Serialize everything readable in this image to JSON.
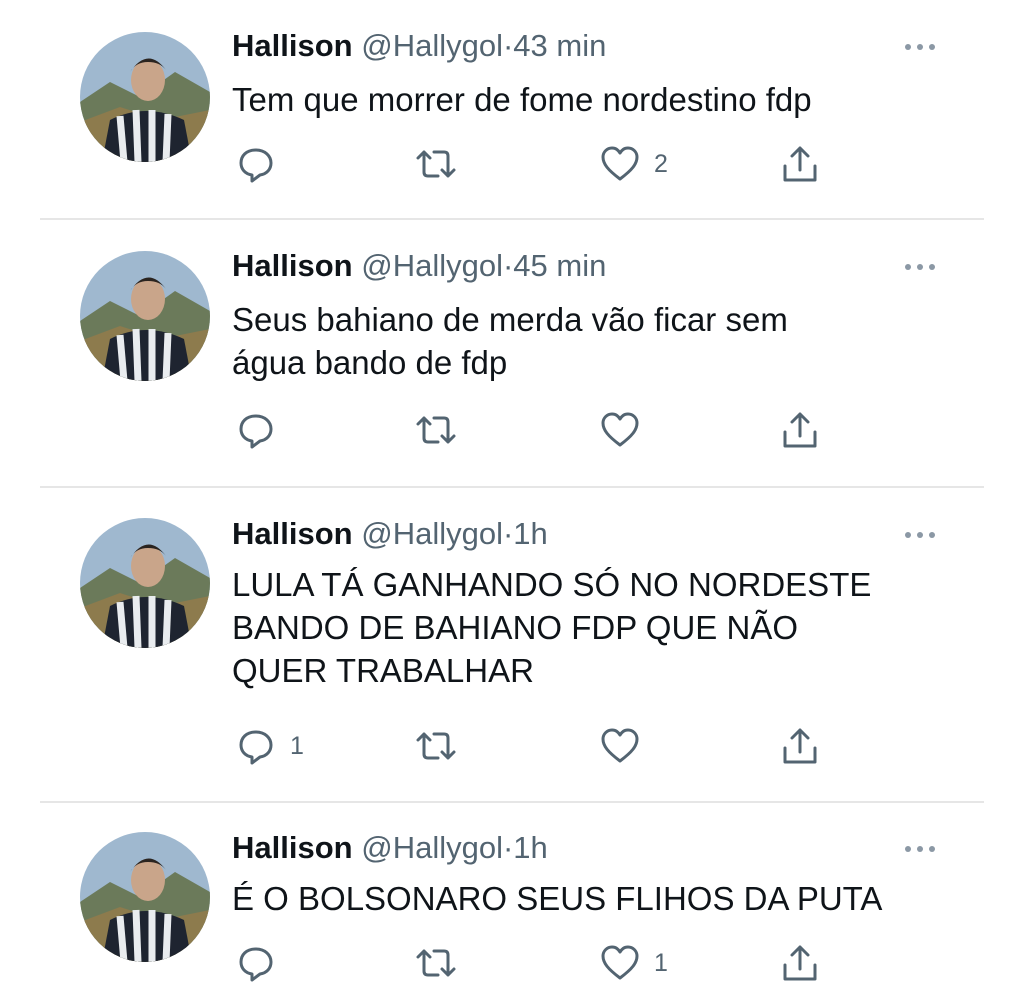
{
  "tweets": [
    {
      "name": "Hallison",
      "handle": "@Hallygol",
      "separator": "·",
      "time": "43 min",
      "lines": [
        "Tem que morrer de fome nordestino fdp"
      ],
      "reply_count": "",
      "retweet_count": "",
      "like_count": "2"
    },
    {
      "name": "Hallison",
      "handle": "@Hallygol",
      "separator": "·",
      "time": "45 min",
      "lines": [
        "Seus bahiano de merda vão ficar sem",
        "água bando de fdp"
      ],
      "reply_count": "",
      "retweet_count": "",
      "like_count": ""
    },
    {
      "name": "Hallison",
      "handle": "@Hallygol",
      "separator": "·",
      "time": "1h",
      "lines": [
        "LULA TÁ GANHANDO SÓ NO NORDESTE",
        "BANDO DE BAHIANO FDP QUE NÃO",
        "QUER TRABALHAR"
      ],
      "reply_count": "1",
      "retweet_count": "",
      "like_count": ""
    },
    {
      "name": "Hallison",
      "handle": "@Hallygol",
      "separator": "·",
      "time": "1h",
      "lines": [
        "É O BOLSONARO SEUS FLIHOS DA PUTA"
      ],
      "reply_count": "",
      "retweet_count": "",
      "like_count": "1"
    }
  ],
  "icons": {
    "reply": "reply-icon",
    "retweet": "retweet-icon",
    "like": "heart-icon",
    "share": "share-icon",
    "more": "more-options-icon"
  },
  "colors": {
    "text": "#0f1419",
    "secondary": "#536471",
    "divider": "#e6e6e6"
  }
}
